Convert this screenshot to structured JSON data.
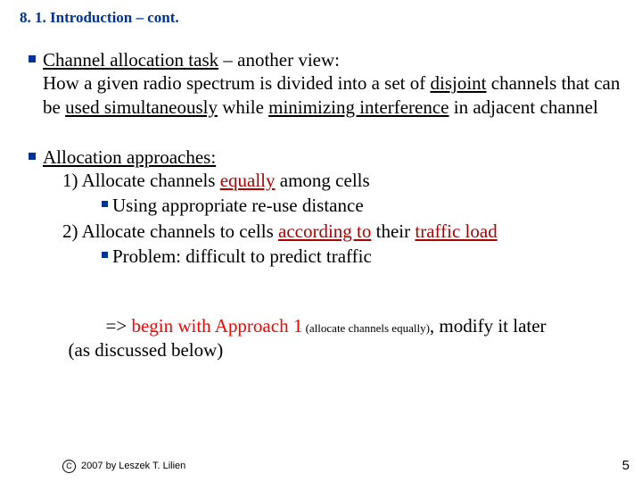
{
  "title": "8. 1. Introduction – cont.",
  "p1": {
    "t1": "Channel allocation task",
    "t2": " – another view:",
    "t3": "How a given radio spectrum is divided into a set of ",
    "t4": "disjoint",
    "t5": " channels that can be ",
    "t6": "used simultaneously",
    "t7": " while ",
    "t8": "minimizing interference",
    "t9": " in adjacent channel"
  },
  "p2": {
    "approaches": "Allocation approaches:",
    "n1": "1) ",
    "l1a": "Allocate channels ",
    "l1b": "equally",
    "l1c": " among cells",
    "sub1": "Using appropriate re-use distance",
    "n2": "2) ",
    "l2a": "Allocate channels to cells ",
    "l2b": "according to",
    "l2c": " their ",
    "l2d": "traffic load",
    "sub2": "Problem: difficult to predict traffic"
  },
  "impl": {
    "t1": "=> ",
    "t2": "begin with Approach 1",
    "t3": " (allocate channels equally)",
    "t4": ", modify it later\n  (as discussed below)"
  },
  "footer": {
    "c": "C",
    "text": " 2007 by Leszek T. Lilien"
  },
  "page": "5"
}
